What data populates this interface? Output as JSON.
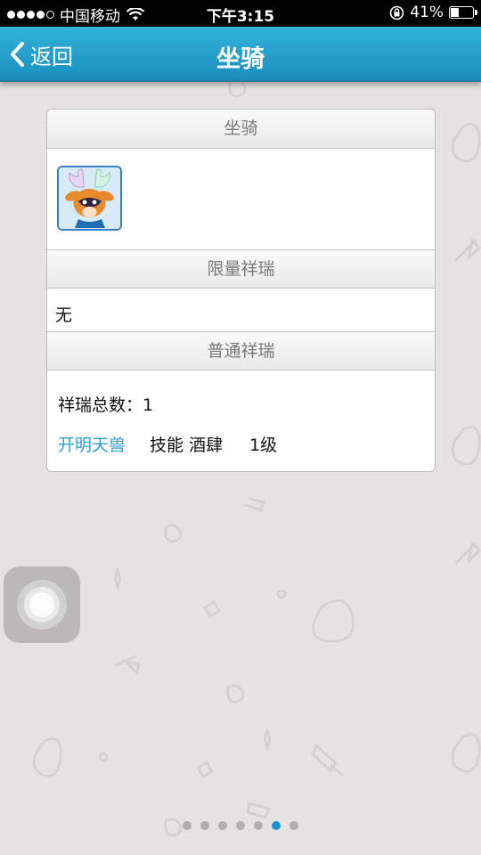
{
  "status_bar": {
    "carrier": "中国移动",
    "time": "下午3:15",
    "battery_percent": "41%",
    "battery_level": 0.41
  },
  "nav": {
    "back_label": "返回",
    "title": "坐骑"
  },
  "card": {
    "mount_header": "坐骑",
    "mount_icon": "deer-mount-icon",
    "limited_header": "限量祥瑞",
    "limited_value": "无",
    "normal_header": "普通祥瑞",
    "total_label": "祥瑞总数：",
    "total_value": "1",
    "pet": {
      "name": "开明天兽",
      "skill_label": "技能",
      "skill_name": "酒肆",
      "level": "1级"
    }
  },
  "page_indicator": {
    "total": 7,
    "active_index": 5
  },
  "colors": {
    "nav_bar": "#1a8ebd",
    "link": "#2b9fd6",
    "active_dot": "#1c8fd0",
    "background": "#e6e2e4"
  }
}
